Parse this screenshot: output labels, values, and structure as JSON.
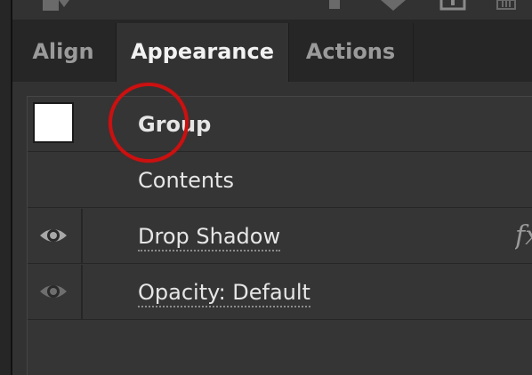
{
  "colors": {
    "panel_bg": "#323232",
    "tabbar_bg": "#262626",
    "active_text": "#f2f2f2",
    "inactive_text": "#9a9a9a",
    "annotation": "#cc1010"
  },
  "toolbar": {
    "icons": [
      "move-to-icon",
      "bar-icon",
      "chevron-down-icon",
      "new-item-icon",
      "trash-icon"
    ]
  },
  "tabs": [
    {
      "label": "Align",
      "active": false
    },
    {
      "label": "Appearance",
      "active": true
    },
    {
      "label": "Actions",
      "active": false
    }
  ],
  "appearance": {
    "group": {
      "label": "Group",
      "thumbnail_color": "#ffffff"
    },
    "contents": {
      "label": "Contents"
    },
    "drop_shadow": {
      "label": "Drop Shadow",
      "visible": true,
      "icon": "eye-icon",
      "fx_label": "fx"
    },
    "opacity": {
      "label": "Opacity: Default",
      "visible": true,
      "icon": "eye-icon"
    }
  },
  "annotation": {
    "shape": "circle",
    "color": "#cc1010",
    "target": "Group"
  }
}
